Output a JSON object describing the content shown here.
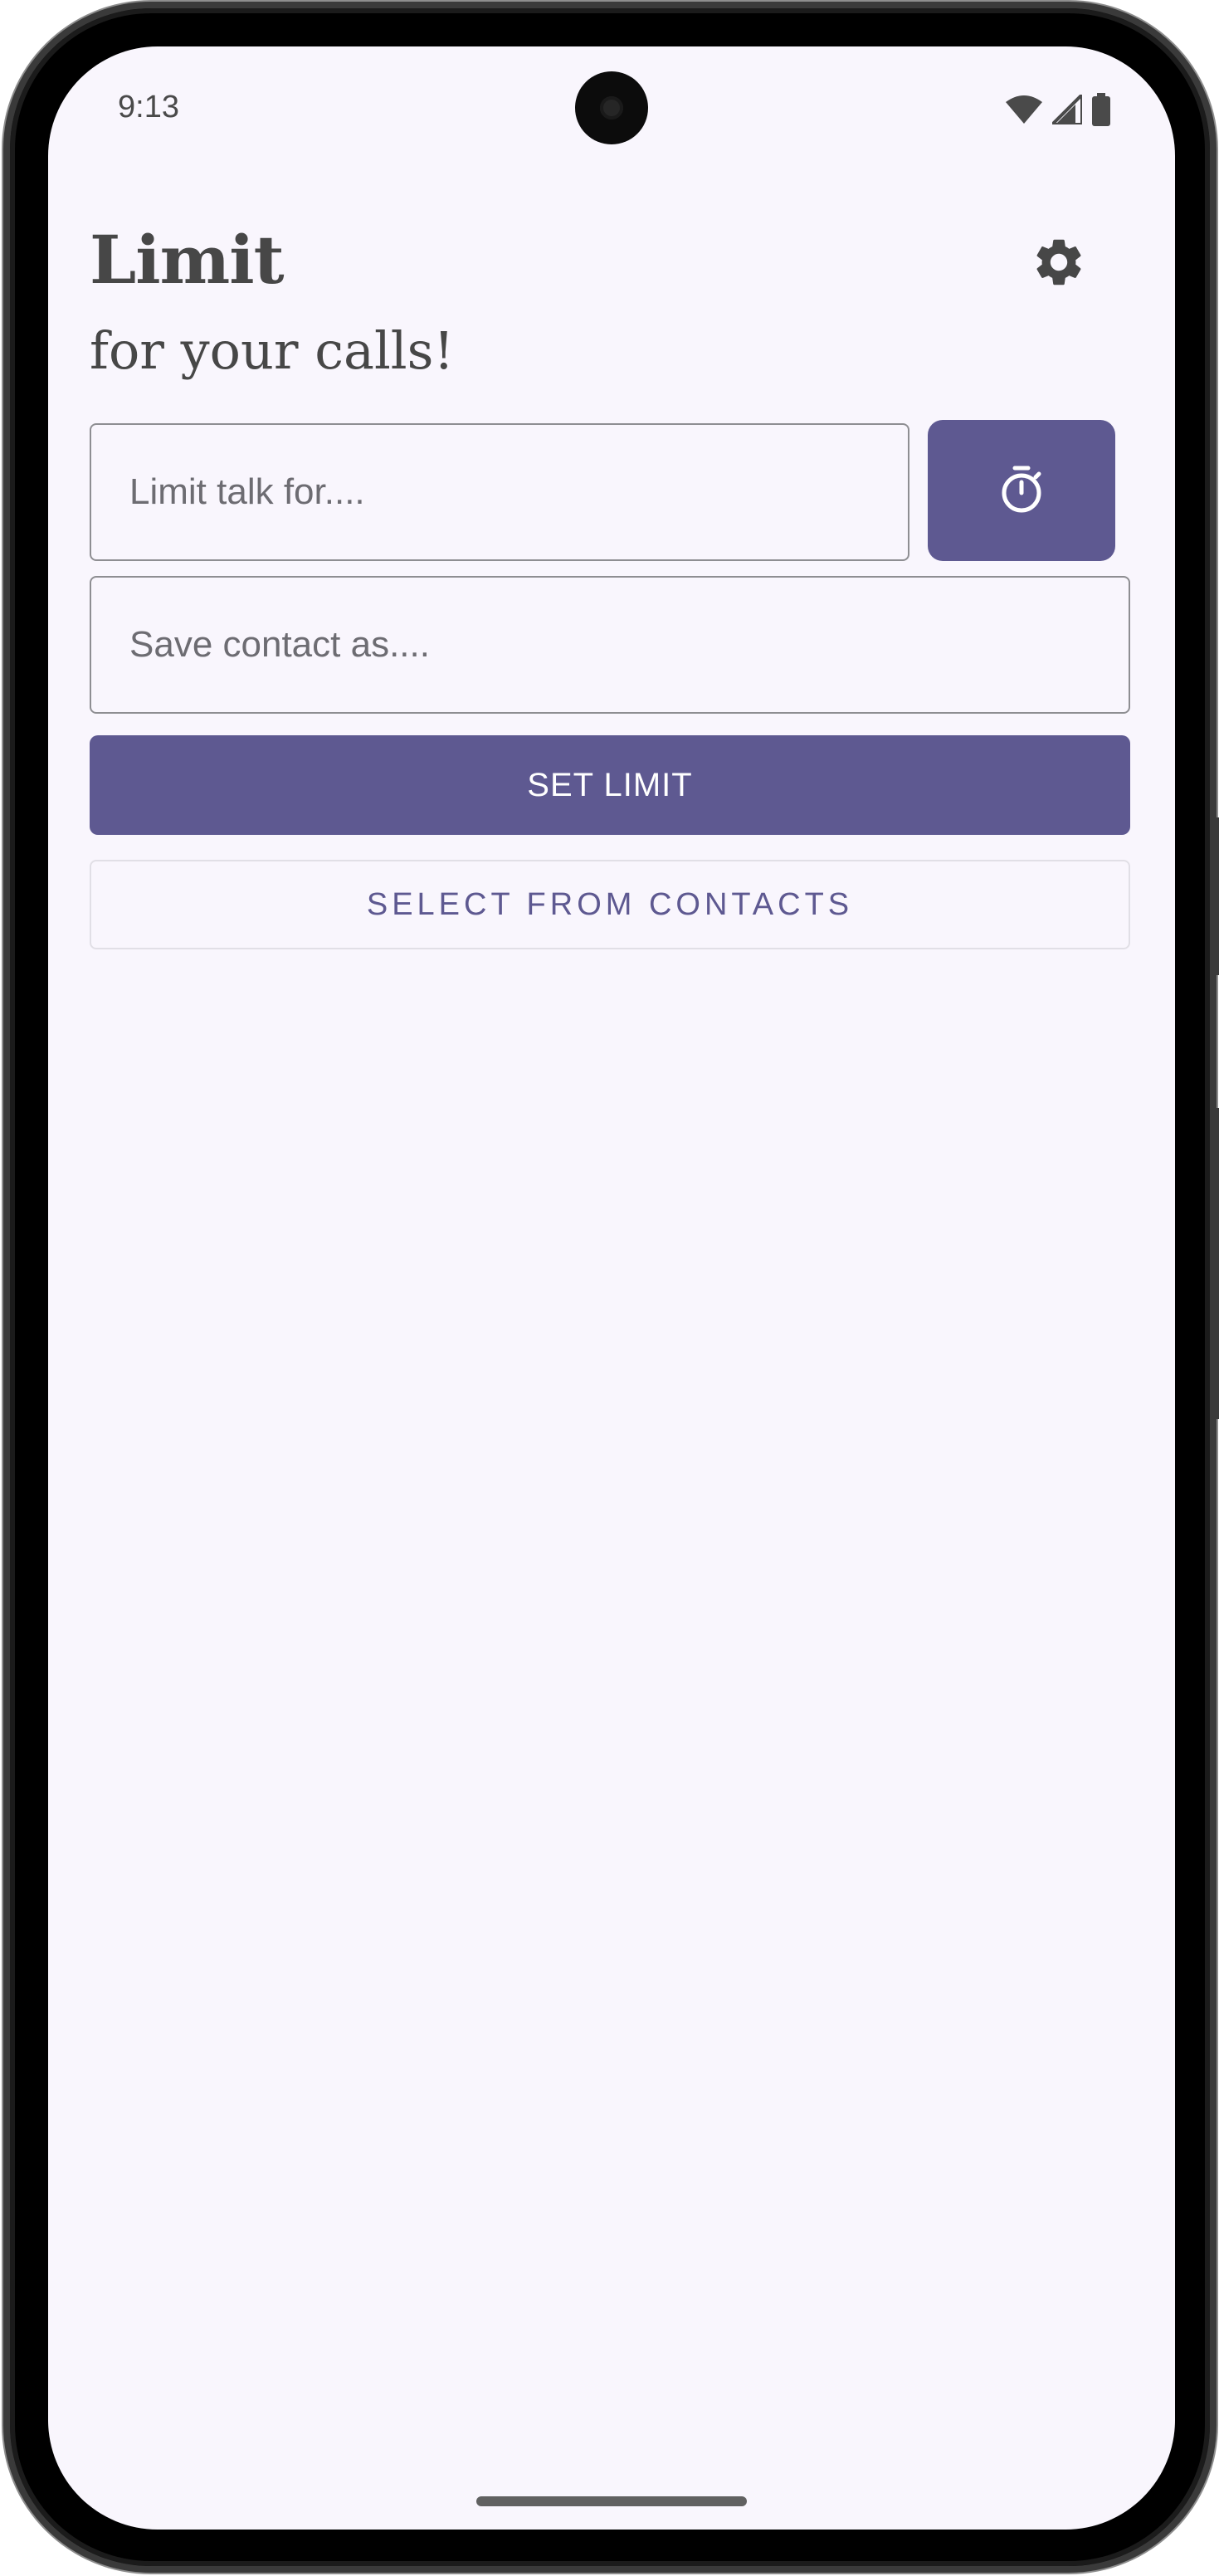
{
  "status_bar": {
    "time": "9:13",
    "icons": [
      "wifi-icon",
      "cellular-signal-icon",
      "battery-icon"
    ]
  },
  "header": {
    "title": "Limit",
    "subtitle": "for your calls!",
    "settings_icon": "gear-icon"
  },
  "form": {
    "limit_placeholder": "Limit talk for....",
    "limit_value": "",
    "timer_icon": "stopwatch-icon",
    "contact_placeholder": "Save contact as....",
    "contact_value": "",
    "set_limit_label": "SET LIMIT",
    "select_contacts_label": "SELECT FROM CONTACTS"
  },
  "colors": {
    "primary": "#5e5991",
    "background": "#f9f6fd",
    "text": "#474747",
    "outline": "#8e8e92"
  }
}
